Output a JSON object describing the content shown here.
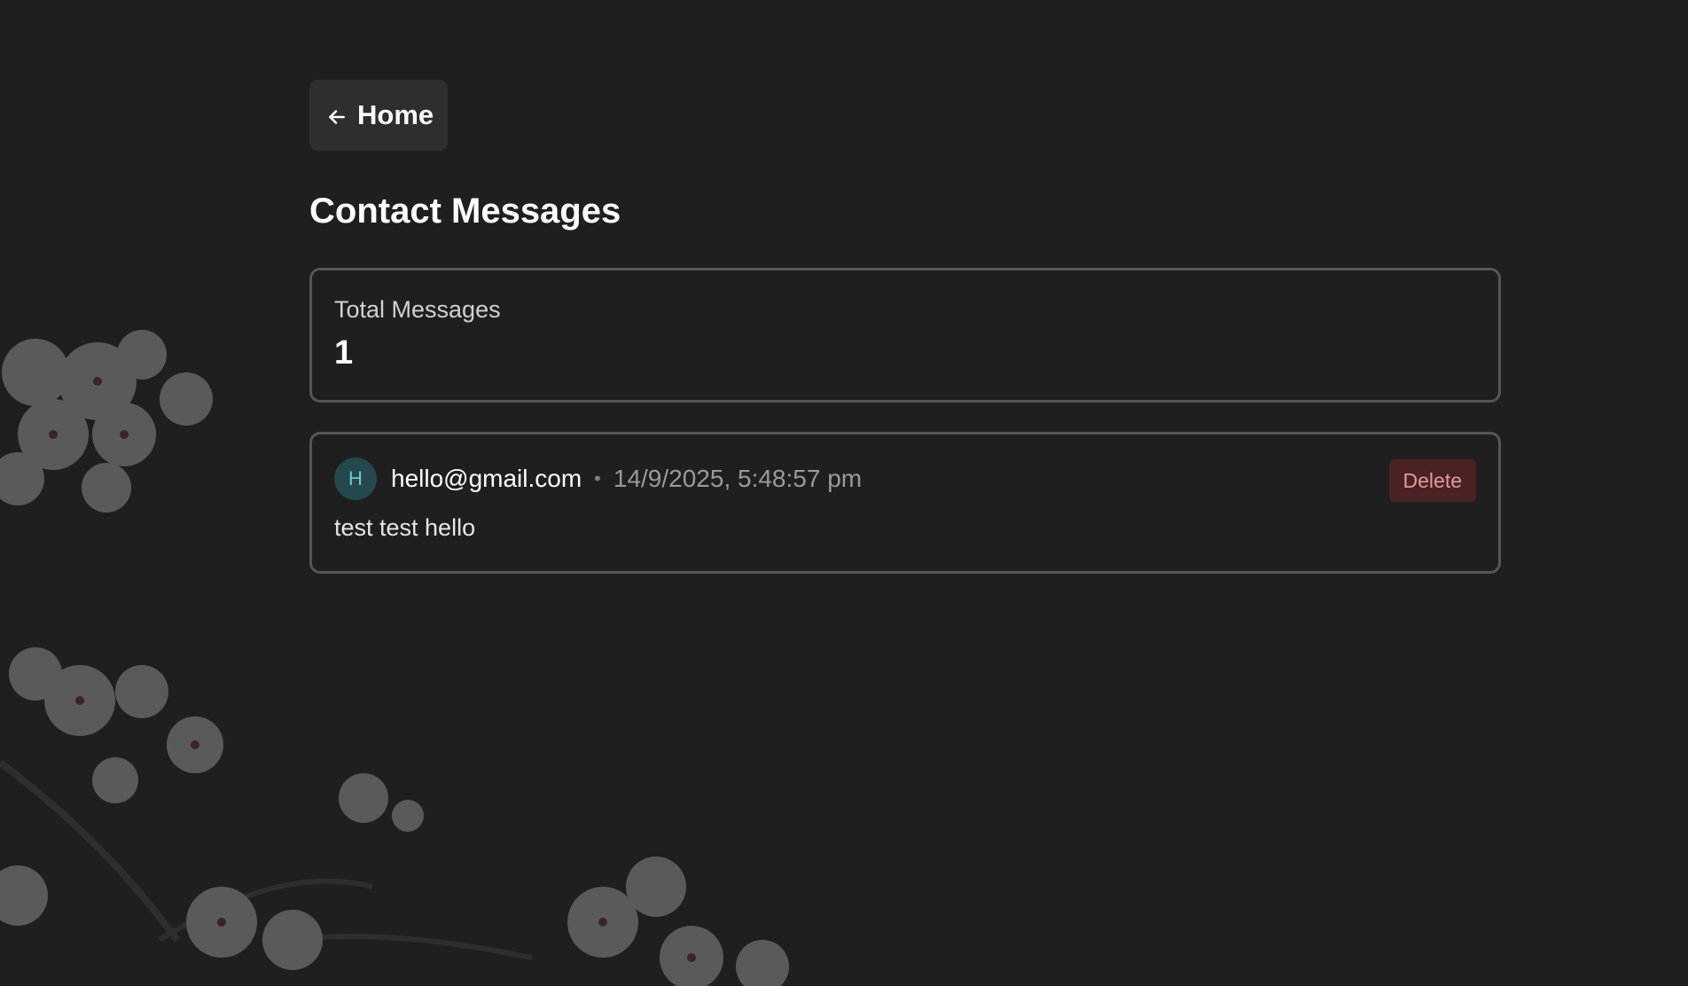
{
  "nav": {
    "home_label": "Home"
  },
  "page": {
    "title": "Contact Messages"
  },
  "stats": {
    "label": "Total Messages",
    "value": "1"
  },
  "messages": [
    {
      "avatar_initial": "H",
      "sender": "hello@gmail.com",
      "separator": "•",
      "timestamp": "14/9/2025, 5:48:57 pm",
      "body": "test test hello",
      "delete_label": "Delete"
    }
  ],
  "icons": {
    "home": "arrow-left-icon"
  },
  "colors": {
    "background": "#1f1f1f",
    "card_border": "#56545c",
    "delete_bg": "#4a2224",
    "delete_text": "#e59a9a",
    "avatar_bg": "#23484d",
    "avatar_text": "#6ec9d0"
  }
}
